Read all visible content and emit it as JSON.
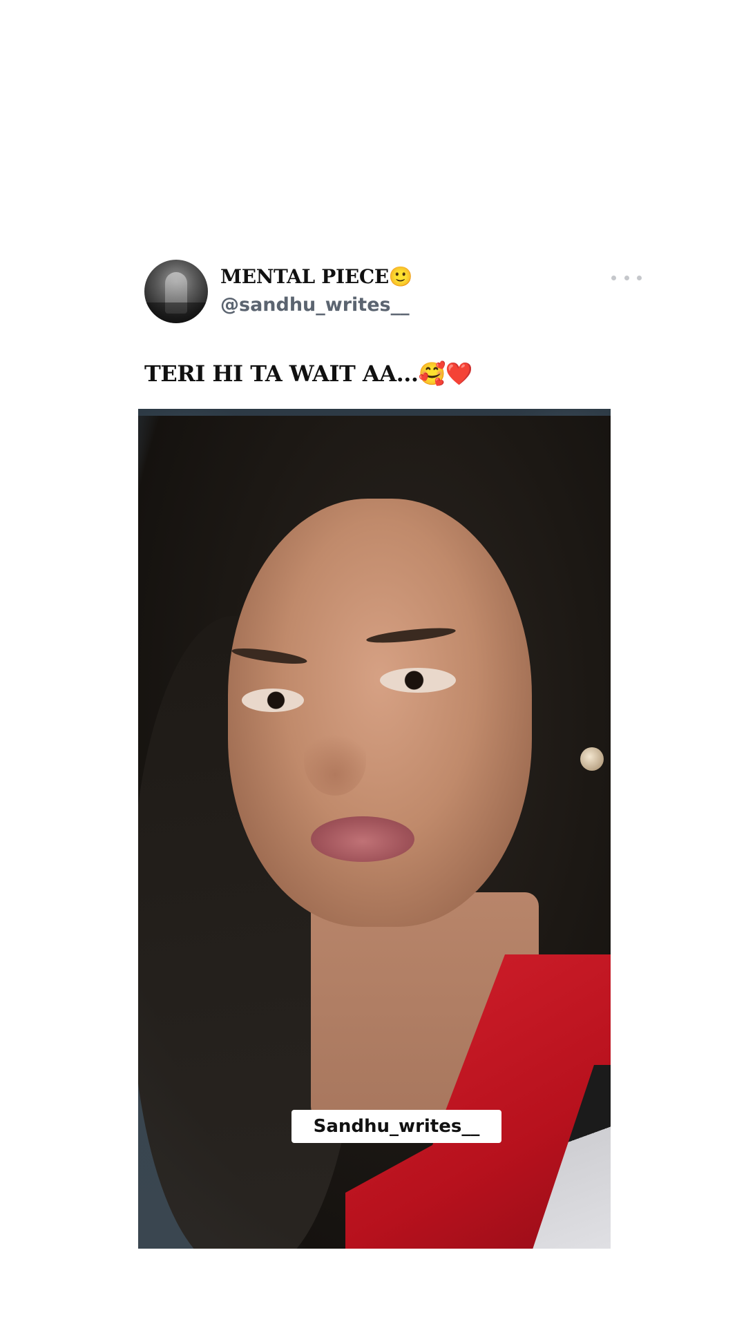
{
  "post": {
    "display_name": "MENTAL PIECE🙂",
    "username": "@sandhu_writes__",
    "caption": "TERI HI TA WAIT AA...🥰❤️",
    "more_icon": "more-horizontal-icon"
  },
  "media": {
    "overlay_text": "Sandhu_writes__"
  },
  "colors": {
    "background": "#ffffff",
    "text_primary": "#111111",
    "text_secondary": "#5b6470",
    "more_dots": "#c5c7cb"
  }
}
